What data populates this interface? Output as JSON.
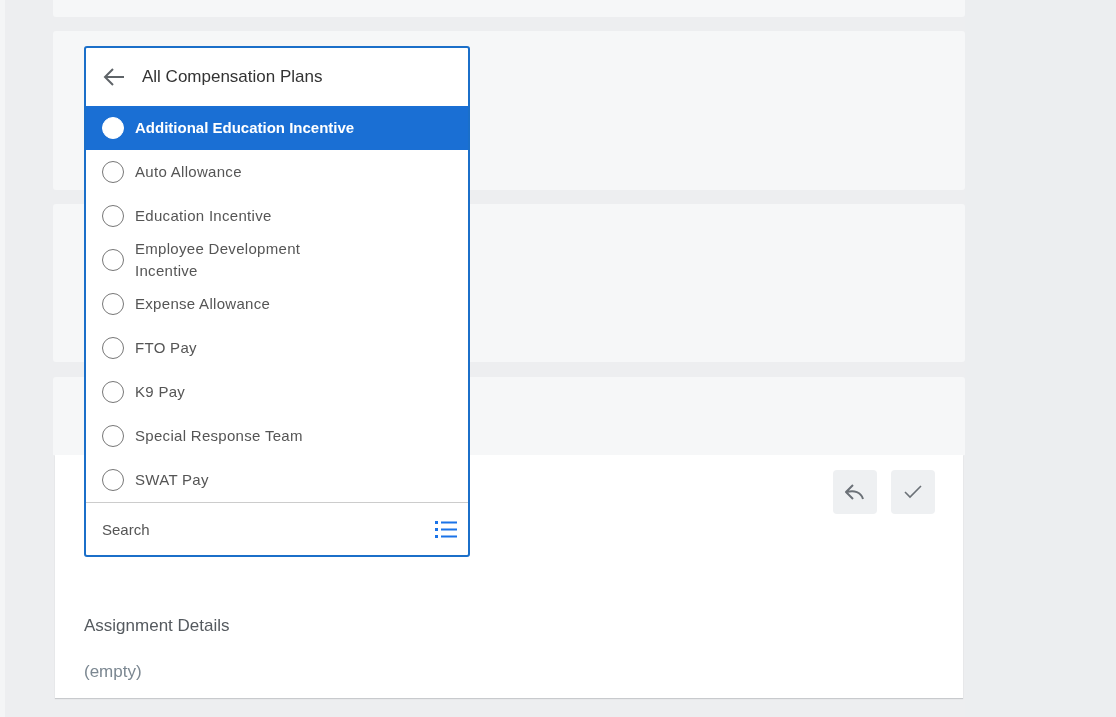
{
  "dropdown": {
    "title": "All Compensation Plans",
    "options": [
      {
        "label": "Additional Education Incentive",
        "selected": true
      },
      {
        "label": "Auto Allowance",
        "selected": false
      },
      {
        "label": "Education Incentive",
        "selected": false
      },
      {
        "label": "Employee Development Incentive",
        "selected": false
      },
      {
        "label": "Expense Allowance",
        "selected": false
      },
      {
        "label": "FTO Pay",
        "selected": false
      },
      {
        "label": "K9 Pay",
        "selected": false
      },
      {
        "label": "Special Response Team",
        "selected": false
      },
      {
        "label": "SWAT Pay",
        "selected": false
      }
    ],
    "search": {
      "placeholder": "Search"
    }
  },
  "details": {
    "label": "Assignment Details",
    "value": "(empty)"
  }
}
